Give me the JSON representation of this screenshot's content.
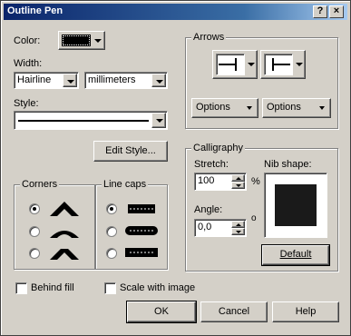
{
  "window": {
    "title": "Outline Pen",
    "help_button": "?",
    "close_button": "×"
  },
  "color": {
    "label": "Color:"
  },
  "width": {
    "label": "Width:",
    "value": "Hairline",
    "units": "millimeters"
  },
  "style": {
    "label": "Style:"
  },
  "edit_style_button": "Edit Style...",
  "corners": {
    "title": "Corners"
  },
  "line_caps": {
    "title": "Line caps"
  },
  "arrows": {
    "title": "Arrows",
    "left_options": "Options",
    "right_options": "Options"
  },
  "calligraphy": {
    "title": "Calligraphy",
    "stretch_label": "Stretch:",
    "stretch_value": "100",
    "stretch_unit": "%",
    "angle_label": "Angle:",
    "angle_value": "0,0",
    "angle_unit": "o",
    "nib_label": "Nib shape:",
    "default_button": "Default"
  },
  "behind_fill": "Behind fill",
  "scale_with_image": "Scale with image",
  "ok_button": "OK",
  "cancel_button": "Cancel",
  "help_button_label": "Help"
}
